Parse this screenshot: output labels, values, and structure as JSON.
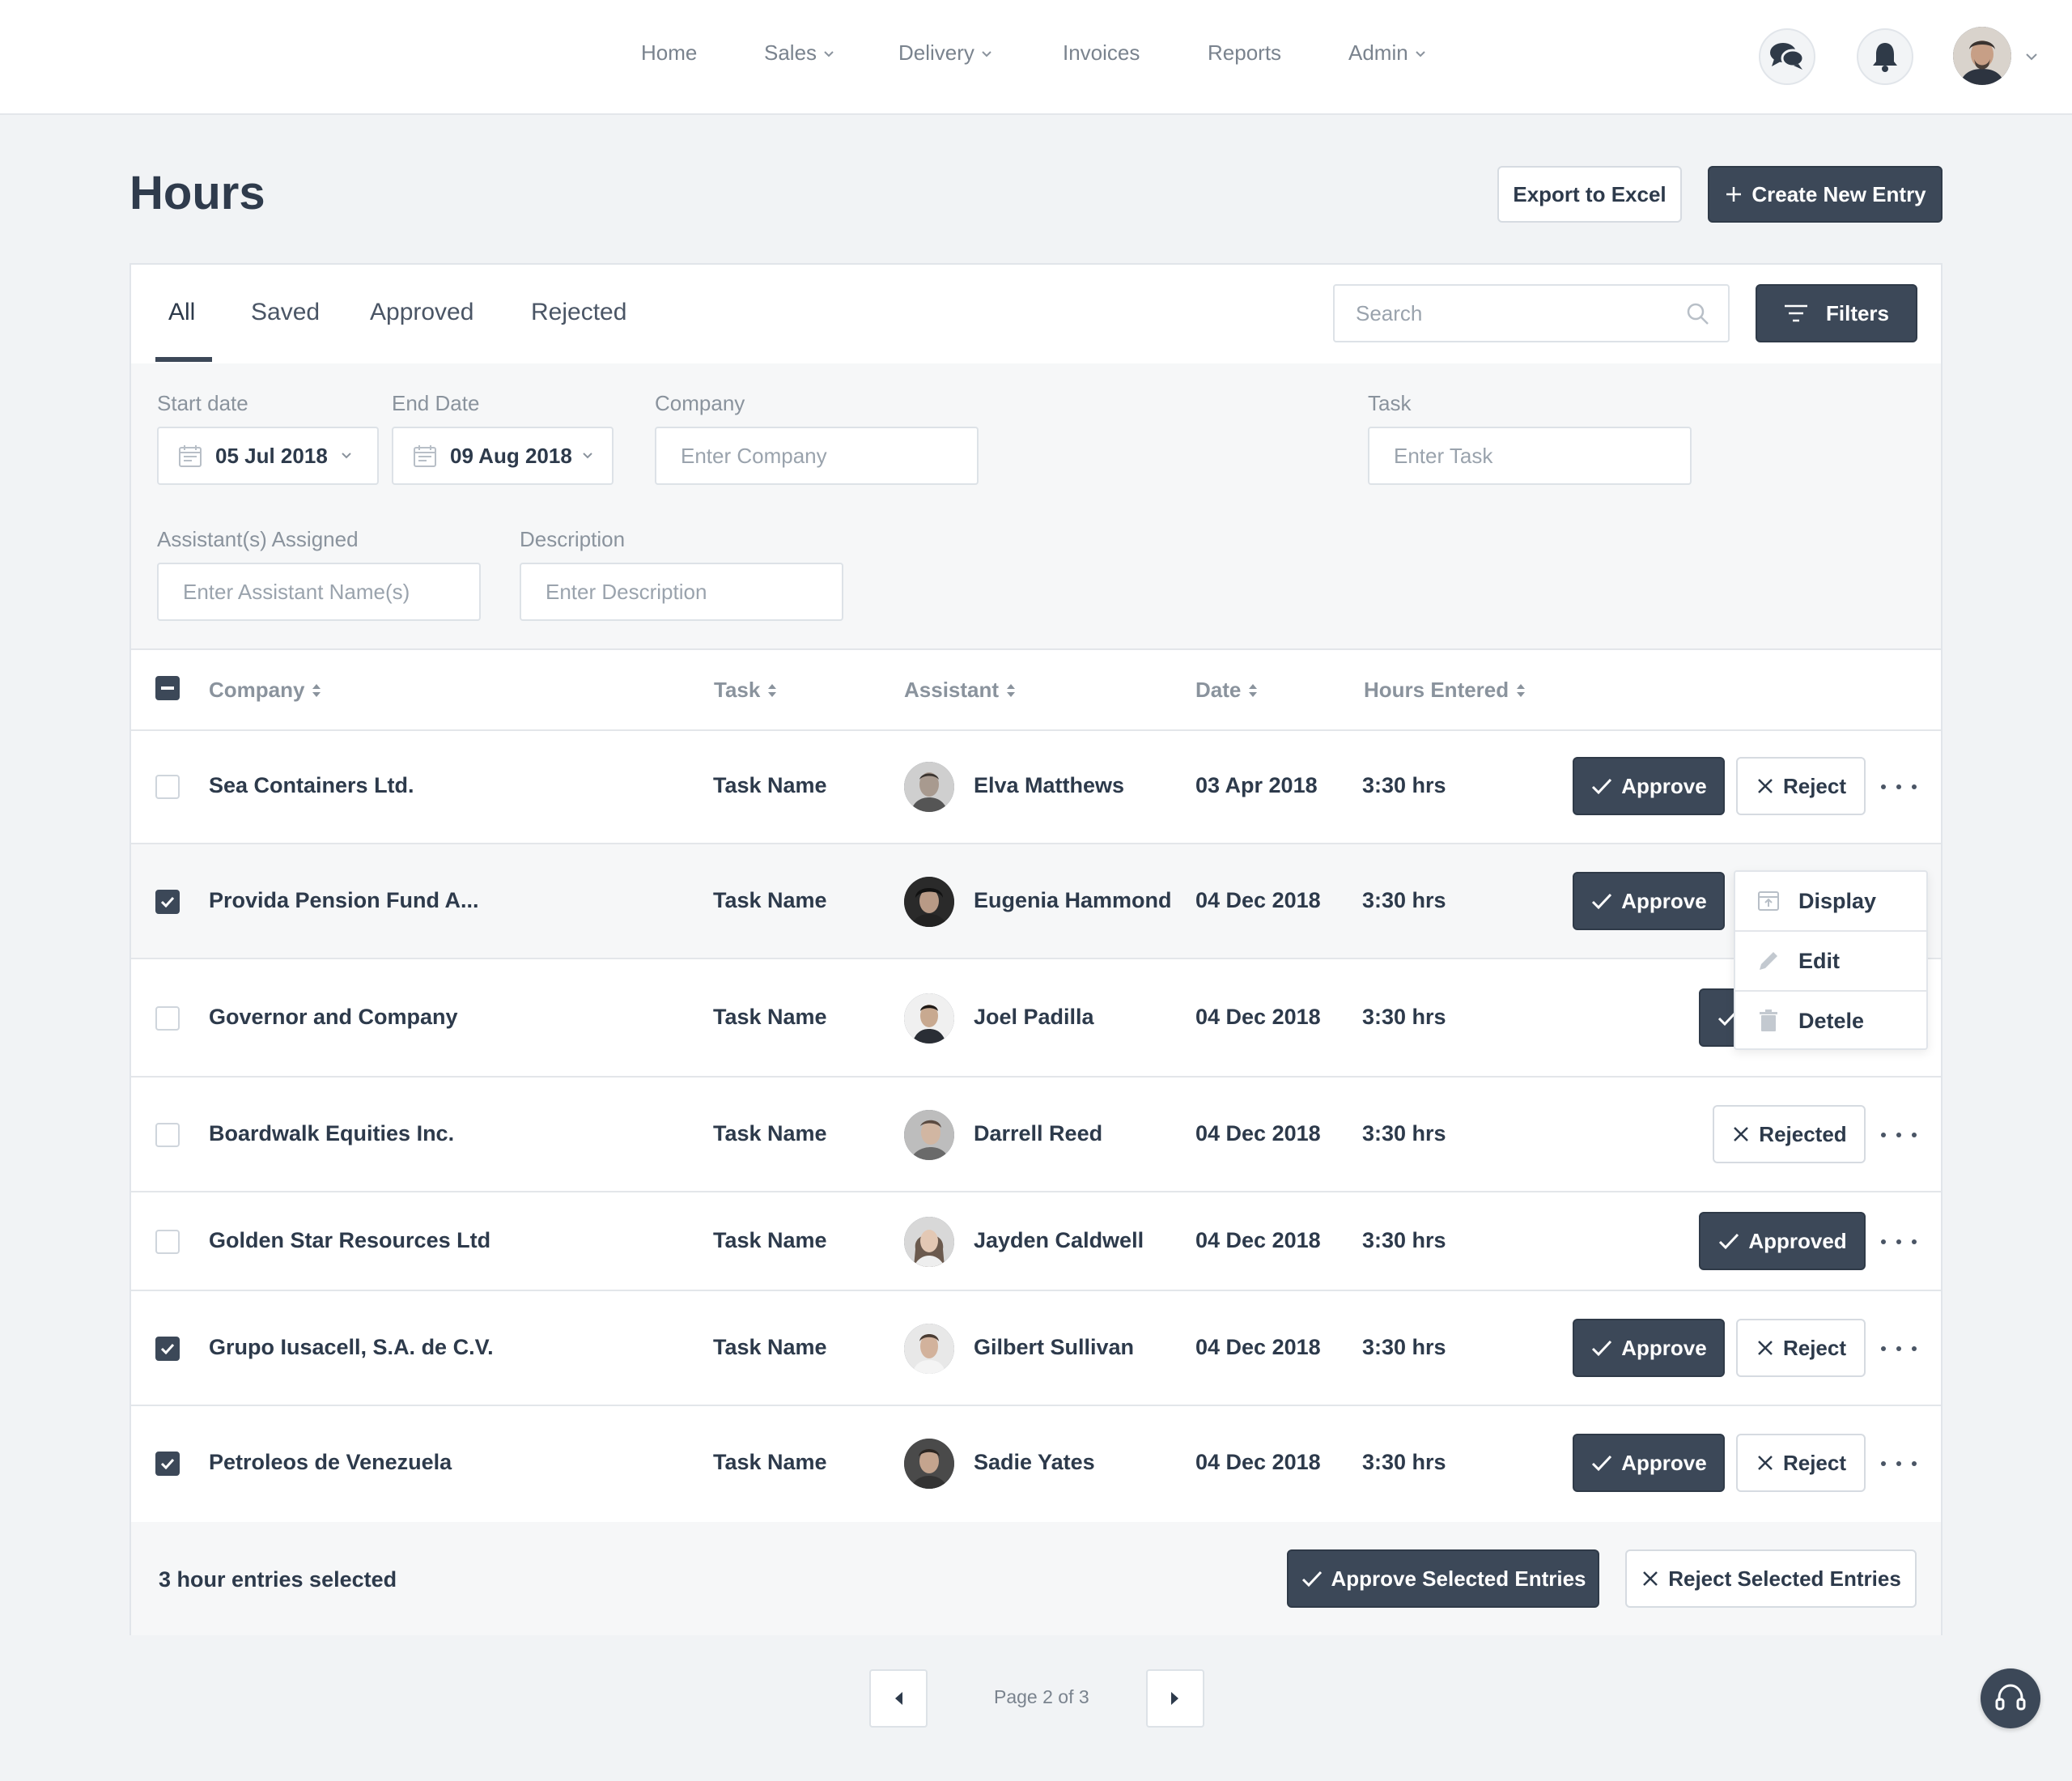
{
  "nav": {
    "items": [
      {
        "label": "Home"
      },
      {
        "label": "Sales"
      },
      {
        "label": "Delivery"
      },
      {
        "label": "Invoices"
      },
      {
        "label": "Reports"
      },
      {
        "label": "Admin"
      }
    ]
  },
  "header": {
    "title": "Hours",
    "export_label": "Export to Excel",
    "create_label": "Create New Entry"
  },
  "tabs": [
    {
      "label": "All",
      "active": true
    },
    {
      "label": "Saved"
    },
    {
      "label": "Approved"
    },
    {
      "label": "Rejected"
    }
  ],
  "search": {
    "placeholder": "Search"
  },
  "filters_button": "Filters",
  "filters": {
    "start_date": {
      "label": "Start date",
      "value": "05 Jul 2018"
    },
    "end_date": {
      "label": "End Date",
      "value": "09 Aug 2018"
    },
    "company": {
      "label": "Company",
      "placeholder": "Enter Company"
    },
    "task": {
      "label": "Task",
      "placeholder": "Enter Task"
    },
    "assistant": {
      "label": "Assistant(s) Assigned",
      "placeholder": "Enter Assistant Name(s)"
    },
    "description": {
      "label": "Description",
      "placeholder": "Enter Description"
    }
  },
  "table": {
    "columns": [
      "Company",
      "Task",
      "Assistant",
      "Date",
      "Hours Entered"
    ],
    "rows": [
      {
        "company": "Sea Containers Ltd.",
        "task": "Task Name",
        "assistant": "Elva Matthews",
        "date": "03 Apr 2018",
        "hours": "3:30 hrs",
        "checked": false,
        "approve": "Approve",
        "reject": "Reject"
      },
      {
        "company": "Provida Pension Fund A...",
        "task": "Task Name",
        "assistant": "Eugenia Hammond",
        "date": "04 Dec 2018",
        "hours": "3:30 hrs",
        "checked": true,
        "approve": "Approve"
      },
      {
        "company": "Governor and Company",
        "task": "Task Name",
        "assistant": "Joel Padilla",
        "date": "04 Dec 2018",
        "hours": "3:30 hrs",
        "checked": false
      },
      {
        "company": "Boardwalk Equities Inc.",
        "task": "Task Name",
        "assistant": "Darrell Reed",
        "date": "04 Dec 2018",
        "hours": "3:30 hrs",
        "checked": false,
        "status": "Rejected"
      },
      {
        "company": "Golden Star Resources Ltd",
        "task": "Task Name",
        "assistant": "Jayden Caldwell",
        "date": "04 Dec 2018",
        "hours": "3:30 hrs",
        "checked": false,
        "status": "Approved"
      },
      {
        "company": "Grupo Iusacell, S.A. de C.V.",
        "task": "Task Name",
        "assistant": "Gilbert Sullivan",
        "date": "04 Dec 2018",
        "hours": "3:30 hrs",
        "checked": true,
        "approve": "Approve",
        "reject": "Reject"
      },
      {
        "company": "Petroleos de Venezuela",
        "task": "Task Name",
        "assistant": "Sadie Yates",
        "date": "04 Dec 2018",
        "hours": "3:30 hrs",
        "checked": true,
        "approve": "Approve",
        "reject": "Reject"
      }
    ]
  },
  "row_menu": {
    "items": [
      {
        "label": "Display",
        "icon": "display-icon"
      },
      {
        "label": "Edit",
        "icon": "pencil-icon"
      },
      {
        "label": "Detele",
        "icon": "trash-icon"
      }
    ]
  },
  "footer": {
    "selected_text": "3 hour entries selected",
    "approve_selected": "Approve Selected Entries",
    "reject_selected": "Reject Selected Entries"
  },
  "pagination": {
    "text": "Page 2 of 3"
  },
  "colors": {
    "primary": "#3c4858",
    "background": "#f1f3f5",
    "muted_text": "#8a939d"
  }
}
